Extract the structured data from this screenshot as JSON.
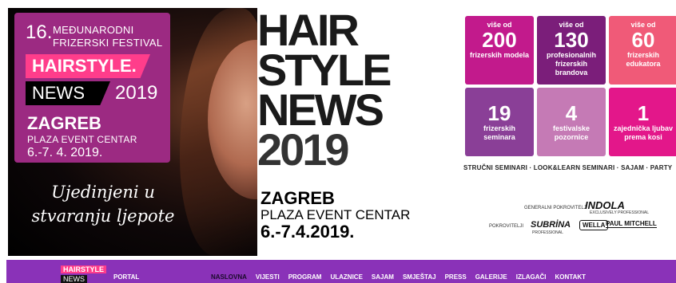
{
  "festival": {
    "number": "16.",
    "line1": "MEĐUNARODNI",
    "line2": "FRIZERSKI FESTIVAL",
    "logo_top": "HAIRSTYLE.",
    "logo_bottom": "NEWS",
    "year": "2019",
    "city": "ZAGREB",
    "venue": "PLAZA EVENT CENTAR",
    "date": "6.-7. 4. 2019.",
    "color": "#9c2a82"
  },
  "slogan": [
    "Ujedinjeni u",
    "stvaranju ljepote"
  ],
  "center": {
    "big_lines": [
      "HAIR",
      "STYLE",
      "NEWS",
      "2019"
    ],
    "city": "ZAGREB",
    "venue": "PLAZA EVENT CENTAR",
    "date": "6.-7.4.2019."
  },
  "stats": [
    {
      "pre": "više od",
      "num": "200",
      "label": "frizerskih modela",
      "color": "#c21a8c"
    },
    {
      "pre": "više od",
      "num": "130",
      "label": "profesionalnih frizerskih brandova",
      "color": "#7b1e7a"
    },
    {
      "pre": "više od",
      "num": "60",
      "label": "frizerskih edukatora",
      "color": "#f05a78"
    },
    {
      "num": "19",
      "label": "frizerskih seminara",
      "color": "#8a3f97"
    },
    {
      "num": "4",
      "label": "festivalske pozornice",
      "color": "#c57ab5"
    },
    {
      "num": "1",
      "label": "zajednička ljubav prema kosi",
      "color": "#e3178a"
    }
  ],
  "tagline": "STRUČNI SEMINARI · LOOK&LEARN SEMINARI · SAJAM · PARTY",
  "sponsors": {
    "general_label": "GENERALNI POKROVITELJ",
    "general": "INDOLA",
    "general_sub": "EXCLUSIVELY PROFESSIONAL",
    "patrons_label": "POKROVITELJI",
    "patrons": [
      "SUBRİNA",
      "WELLA",
      "PAUL MITCHELL"
    ],
    "subrina_sub": "PROFESSIONAL"
  },
  "nav": {
    "logo_top": "HAIRSTYLE",
    "logo_bottom": "NEWS",
    "portal": "PORTAL",
    "items": [
      "NASLOVNA",
      "VIJESTI",
      "PROGRAM",
      "ULAZNICE",
      "SAJAM",
      "SMJEŠTAJ",
      "PRESS",
      "GALERIJE",
      "IZLAGAČI",
      "KONTAKT"
    ],
    "active": "NASLOVNA",
    "color": "#8a32b8"
  }
}
